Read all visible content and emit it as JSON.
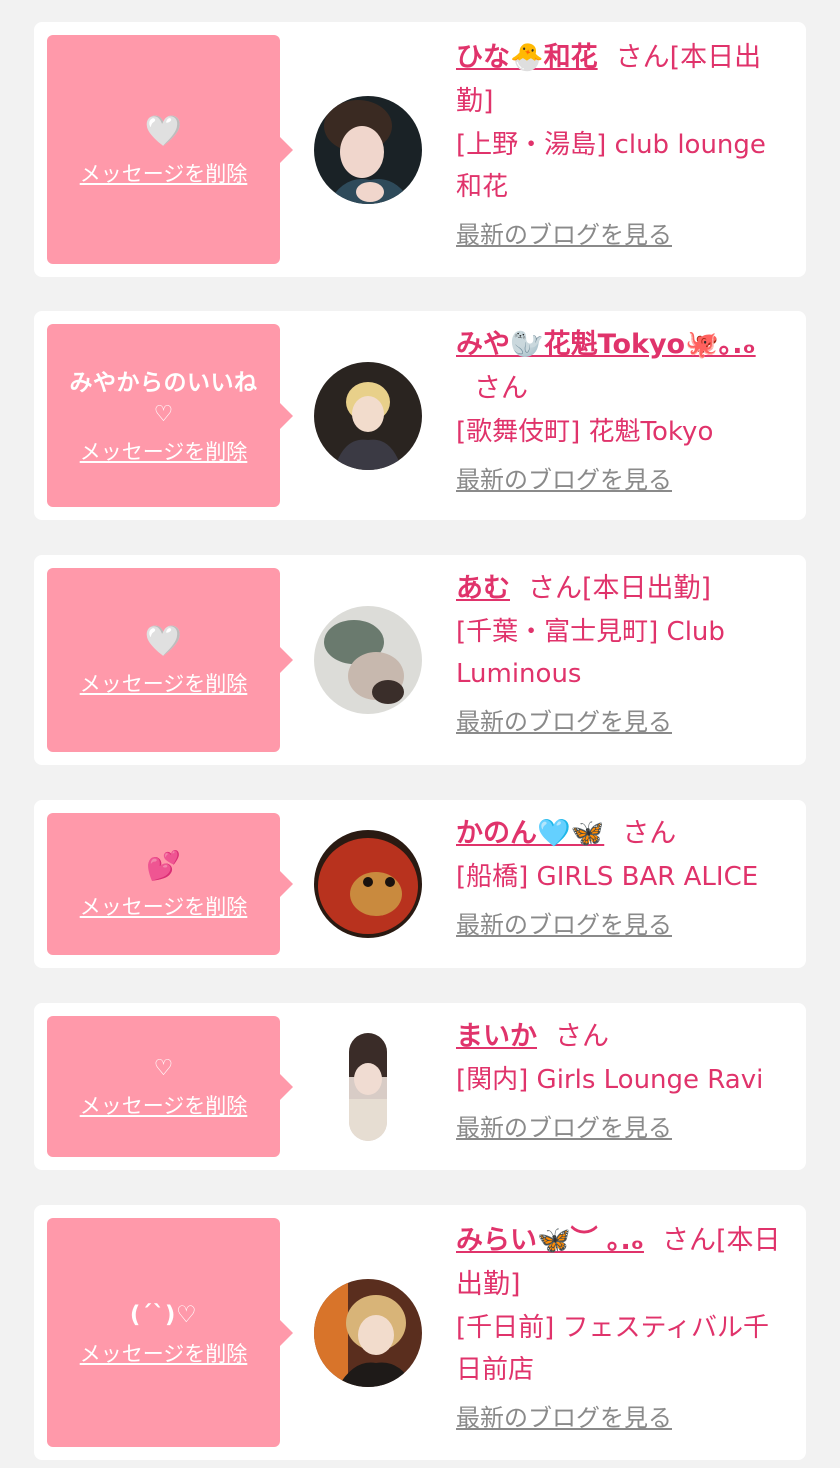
{
  "messages": [
    {
      "message": "",
      "heart": "🤍",
      "delete_label": "メッセージを削除",
      "name": "ひな🐣和花",
      "honorific": "さん",
      "status": "[本日出勤]",
      "shop": "[上野・湯島] club lounge 和花",
      "blog_label": "最新のブログを見る"
    },
    {
      "message": "みやからのいいね",
      "heart": "♡",
      "delete_label": "メッセージを削除",
      "name": "みや🦭花魁Tokyo🐙｡.ₒ",
      "honorific": "さん",
      "status": "",
      "shop": "[歌舞伎町] 花魁Tokyo",
      "blog_label": "最新のブログを見る"
    },
    {
      "message": "",
      "heart": "🤍",
      "delete_label": "メッセージを削除",
      "name": "あむ",
      "honorific": "さん",
      "status": "[本日出勤]",
      "shop": "[千葉・富士見町] Club Luminous",
      "blog_label": "最新のブログを見る"
    },
    {
      "message": "",
      "heart": "💕",
      "delete_label": "メッセージを削除",
      "name": "かのん🩵🦋",
      "honorific": "さん",
      "status": "",
      "shop": "[船橋] GIRLS BAR ALICE",
      "blog_label": "最新のブログを見る"
    },
    {
      "message": "",
      "heart": "♡",
      "delete_label": "メッセージを削除",
      "name": "まいか",
      "honorific": "さん",
      "status": "",
      "shop": "[関内] Girls Lounge Ravi",
      "blog_label": "最新のブログを見る"
    },
    {
      "message": "(ˊˋ)♡",
      "heart": "",
      "delete_label": "メッセージを削除",
      "name": "みらい🦋︶ ｡.ₒ",
      "honorific": "さん",
      "status": "[本日出勤]",
      "shop": "[千日前] フェスティバル千日前店",
      "blog_label": "最新のブログを見る"
    }
  ],
  "colors": {
    "background": "#f2f2f2",
    "card": "#ffffff",
    "bubble": "#ff99aa",
    "accent": "#e0336b",
    "muted": "#8a8a8a"
  }
}
